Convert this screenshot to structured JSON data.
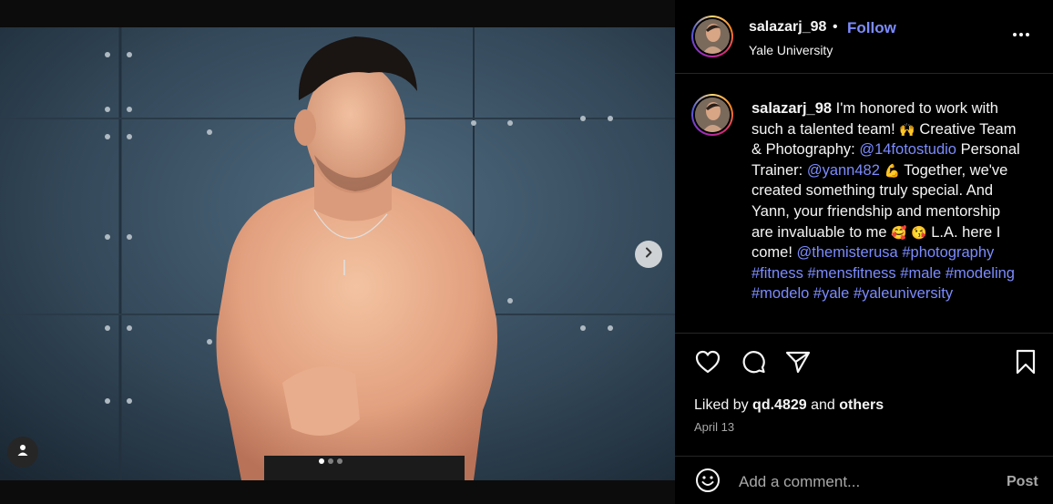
{
  "post": {
    "username": "salazarj_98",
    "separator": "•",
    "follow_label": "Follow",
    "location": "Yale University",
    "carousel": {
      "total": 3,
      "active": 1
    },
    "icons": {
      "next": "chevron-right-icon",
      "tagged": "person-icon",
      "more": "ellipsis-icon",
      "like": "heart-icon",
      "comment": "comment-bubble-icon",
      "share": "paper-plane-icon",
      "save": "bookmark-icon",
      "emoji": "smiley-icon"
    },
    "colors": {
      "link": "#7c8cff",
      "muted": "#a8a8a8",
      "panel": "#000000"
    }
  },
  "caption": {
    "username": "salazarj_98",
    "part1": " I'm honored to work with such a talented team! ",
    "emoji1": "🙌",
    "part2": " Creative Team & Photography: ",
    "mention1": "@14fotostudio",
    "part3": " Personal Trainer: ",
    "mention2": "@yann482",
    "emoji2": "💪",
    "part4": " Together, we've created something truly special. And Yann, your friendship and mentorship are invaluable to me ",
    "emoji3": "🥰",
    "emoji4": "😘",
    "part5": " L.A. here I come! ",
    "mention3": "@themisterusa",
    "hashtags": [
      "#photography",
      "#fitness",
      "#mensfitness",
      "#male",
      "#modeling",
      "#modelo",
      "#yale",
      "#yaleuniversity"
    ]
  },
  "likes": {
    "prefix": "Liked by ",
    "user": "qd.4829",
    "middle": " and ",
    "others": "others"
  },
  "date": "April 13",
  "comment": {
    "placeholder": "Add a comment...",
    "post_label": "Post"
  }
}
